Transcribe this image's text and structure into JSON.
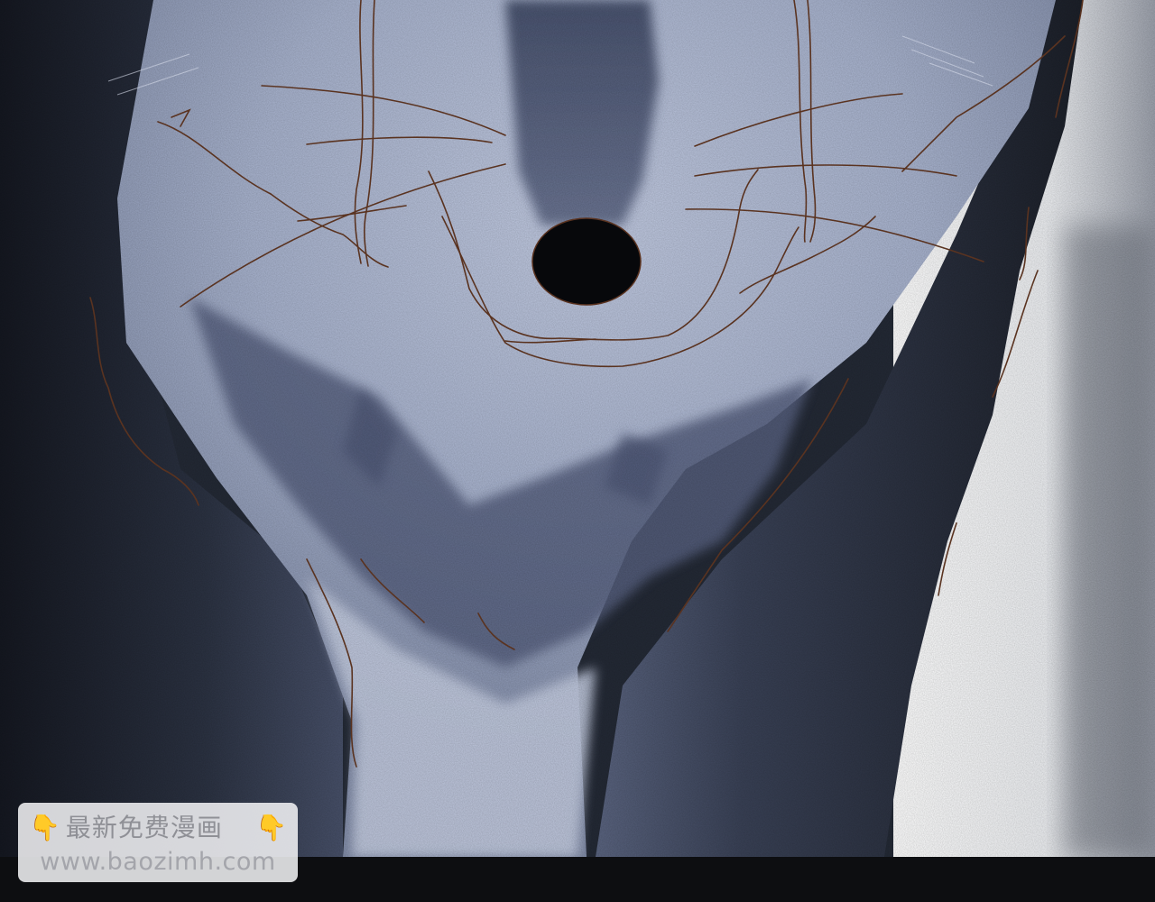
{
  "scene": {
    "subject": "wolf-face-closeup",
    "colors": {
      "background_dark": "#0e0f12",
      "fur_dark": "#2d3443",
      "fur_mid": "#5c6580",
      "fur_light": "#b9c3dc",
      "nose": "#07080b",
      "line_art": "#5a3320",
      "highlight_right": "#f2f3f5"
    }
  },
  "watermark": {
    "title": "最新免费漫画",
    "url": "www.baozimh.com",
    "left_icon": "pointing-down-hand-icon",
    "right_icon": "pointing-down-hand-icon",
    "hand_glyph": "👇"
  }
}
